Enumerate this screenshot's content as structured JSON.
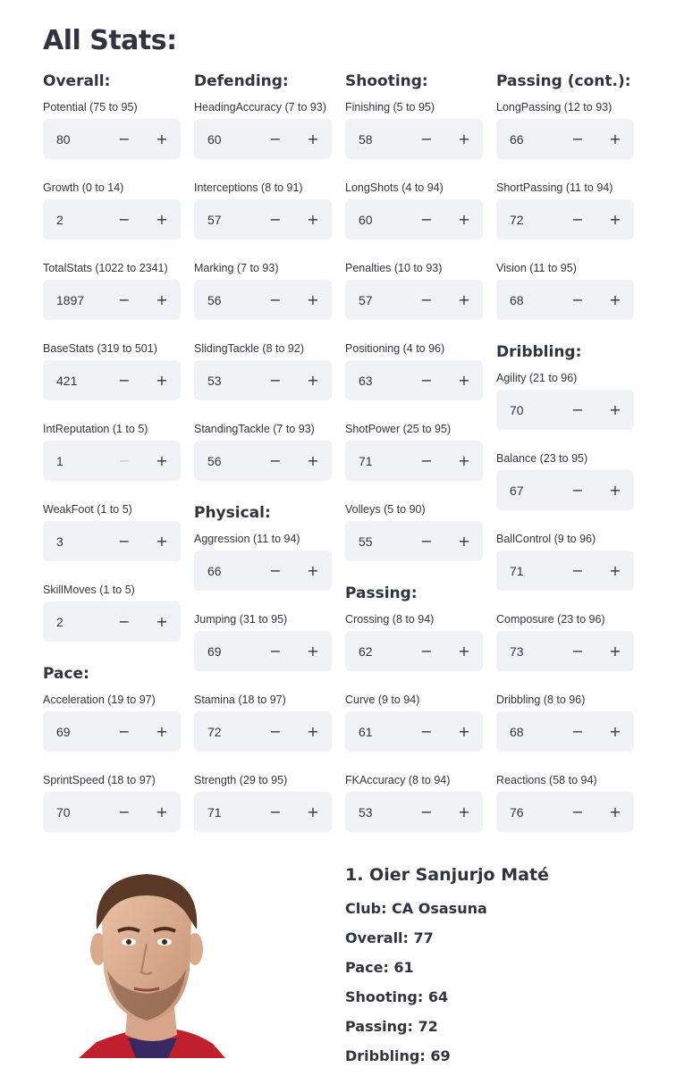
{
  "page": {
    "title": "All Stats:"
  },
  "columns": [
    {
      "sections": [
        {
          "title": "Overall:",
          "fields": [
            {
              "label": "Potential (75 to 95)",
              "value": "80"
            },
            {
              "label": "Growth (0 to 14)",
              "value": "2"
            },
            {
              "label": "TotalStats (1022 to 2341)",
              "value": "1897"
            },
            {
              "label": "BaseStats (319 to 501)",
              "value": "421"
            },
            {
              "label": "IntReputation (1 to 5)",
              "value": "1",
              "minus_disabled": true
            },
            {
              "label": "WeakFoot (1 to 5)",
              "value": "3"
            },
            {
              "label": "SkillMoves (1 to 5)",
              "value": "2"
            }
          ]
        },
        {
          "title": "Pace:",
          "fields": [
            {
              "label": "Acceleration (19 to 97)",
              "value": "69"
            },
            {
              "label": "SprintSpeed (18 to 97)",
              "value": "70"
            }
          ]
        }
      ]
    },
    {
      "sections": [
        {
          "title": "Defending:",
          "fields": [
            {
              "label": "HeadingAccuracy (7 to 93)",
              "value": "60"
            },
            {
              "label": "Interceptions (8 to 91)",
              "value": "57"
            },
            {
              "label": "Marking (7 to 93)",
              "value": "56"
            },
            {
              "label": "SlidingTackle (8 to 92)",
              "value": "53"
            },
            {
              "label": "StandingTackle (7 to 93)",
              "value": "56"
            }
          ]
        },
        {
          "title": "Physical:",
          "fields": [
            {
              "label": "Aggression (11 to 94)",
              "value": "66"
            },
            {
              "label": "Jumping (31 to 95)",
              "value": "69"
            },
            {
              "label": "Stamina (18 to 97)",
              "value": "72"
            },
            {
              "label": "Strength (29 to 95)",
              "value": "71"
            }
          ]
        }
      ]
    },
    {
      "sections": [
        {
          "title": "Shooting:",
          "fields": [
            {
              "label": "Finishing (5 to 95)",
              "value": "58"
            },
            {
              "label": "LongShots (4 to 94)",
              "value": "60"
            },
            {
              "label": "Penalties (10 to 93)",
              "value": "57"
            },
            {
              "label": "Positioning (4 to 96)",
              "value": "63"
            },
            {
              "label": "ShotPower (25 to 95)",
              "value": "71"
            },
            {
              "label": "Volleys (5 to 90)",
              "value": "55"
            }
          ]
        },
        {
          "title": "Passing:",
          "fields": [
            {
              "label": "Crossing (8 to 94)",
              "value": "62"
            },
            {
              "label": "Curve (9 to 94)",
              "value": "61"
            },
            {
              "label": "FKAccuracy (8 to 94)",
              "value": "53"
            }
          ]
        }
      ]
    },
    {
      "sections": [
        {
          "title": "Passing (cont.):",
          "fields": [
            {
              "label": "LongPassing (12 to 93)",
              "value": "66"
            },
            {
              "label": "ShortPassing (11 to 94)",
              "value": "72"
            },
            {
              "label": "Vision (11 to 95)",
              "value": "68"
            }
          ]
        },
        {
          "title": "Dribbling:",
          "fields": [
            {
              "label": "Agility (21 to 96)",
              "value": "70"
            },
            {
              "label": "Balance (23 to 95)",
              "value": "67"
            },
            {
              "label": "BallControl (9 to 96)",
              "value": "71"
            },
            {
              "label": "Composure (23 to 96)",
              "value": "73"
            },
            {
              "label": "Dribbling (8 to 96)",
              "value": "68"
            },
            {
              "label": "Reactions (58 to 94)",
              "value": "76"
            }
          ]
        }
      ]
    }
  ],
  "stepper": {
    "minus": "−",
    "plus": "+"
  },
  "player": {
    "name": "1. Oier Sanjurjo Maté",
    "stats": [
      {
        "label": "Club",
        "value": "CA Osasuna"
      },
      {
        "label": "Overall",
        "value": "77"
      },
      {
        "label": "Pace",
        "value": "61"
      },
      {
        "label": "Shooting",
        "value": "64"
      },
      {
        "label": "Passing",
        "value": "72"
      },
      {
        "label": "Dribbling",
        "value": "69"
      }
    ]
  },
  "colors": {
    "input_bg": "#f0f2f6",
    "text": "#31333f",
    "disabled": "#c8c9cf",
    "jersey": "#c0202e"
  }
}
